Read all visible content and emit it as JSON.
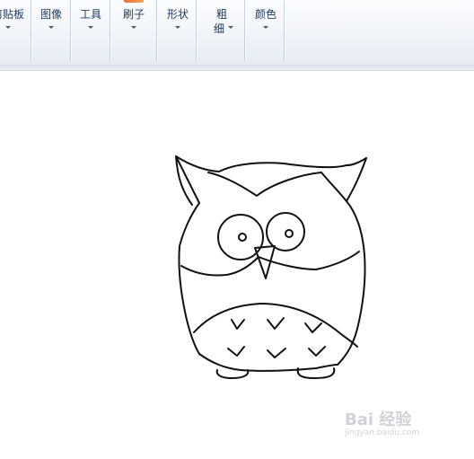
{
  "ribbon": {
    "groups": [
      {
        "label": "剪贴板"
      },
      {
        "label": "图像"
      },
      {
        "label": "工具"
      },
      {
        "label": "刷子"
      },
      {
        "label": "形状"
      },
      {
        "label_line1": "粗",
        "label_line2": "细"
      },
      {
        "label": "颜色"
      }
    ]
  },
  "canvas": {
    "drawing": "owl-sketch",
    "stroke_color": "#111111"
  },
  "watermark": {
    "text": "Bai 经验",
    "sub": "jingyan.baidu.com"
  }
}
